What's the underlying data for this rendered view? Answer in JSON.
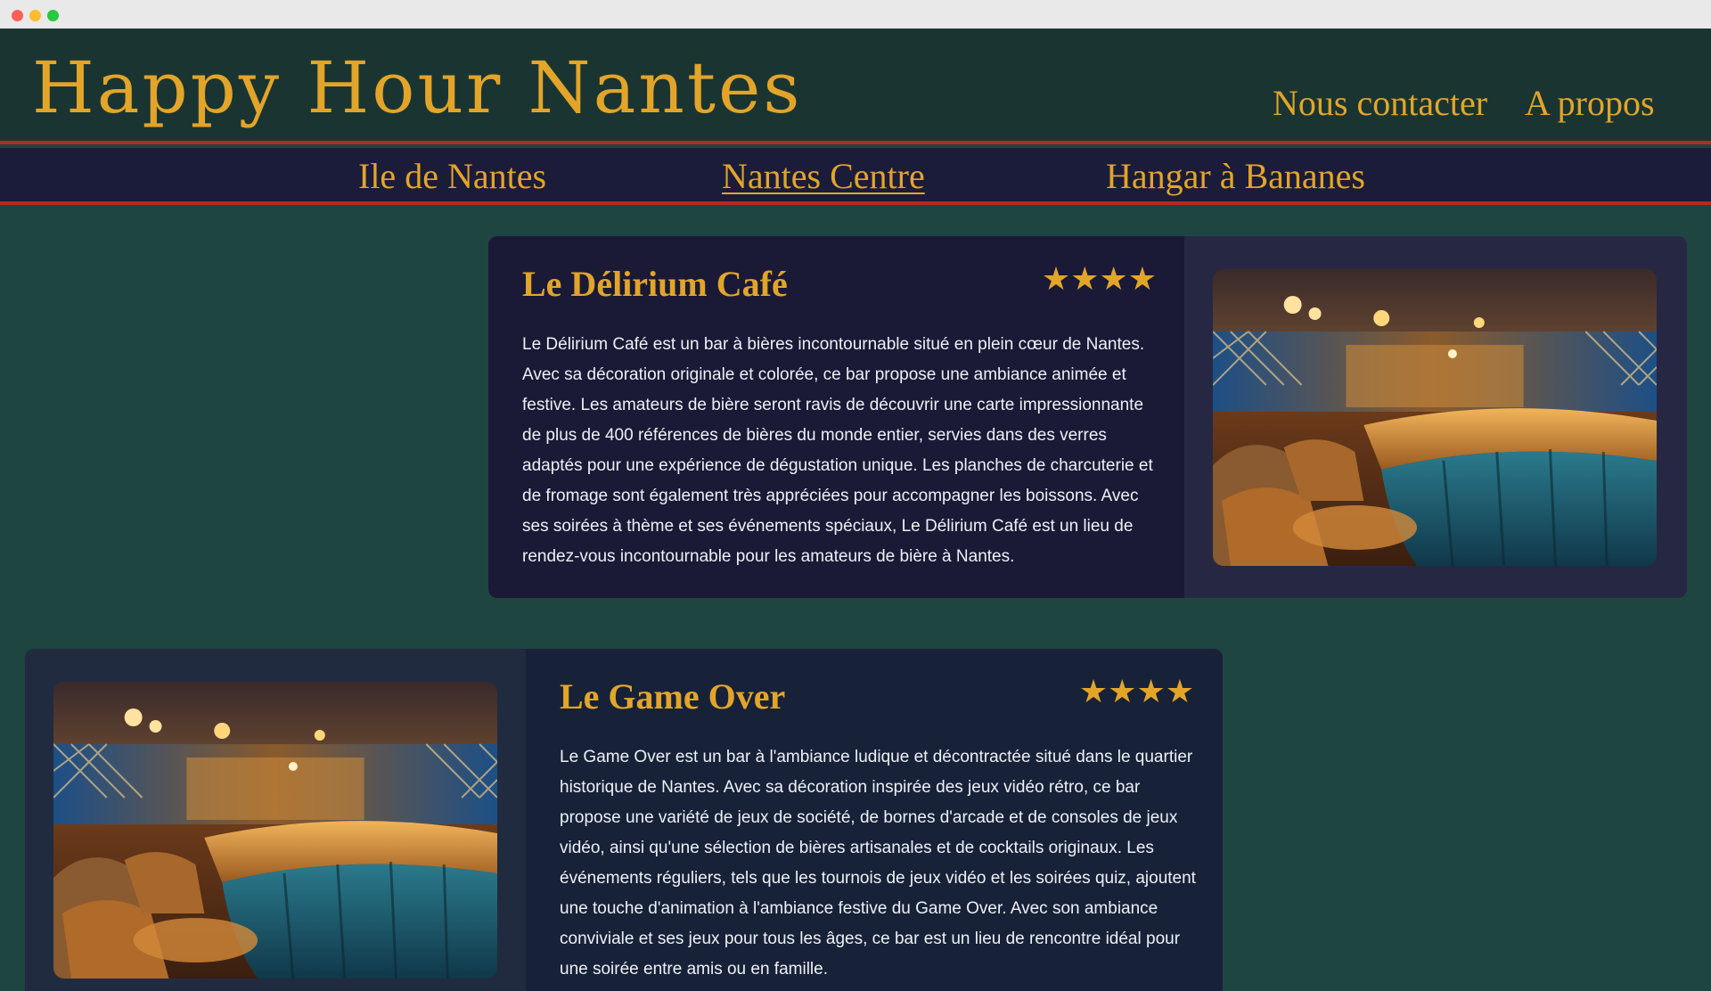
{
  "site": {
    "title": "Happy Hour Nantes"
  },
  "header": {
    "links": [
      {
        "label": "Nous contacter"
      },
      {
        "label": "A propos"
      }
    ]
  },
  "nav": {
    "items": [
      {
        "label": "Ile de Nantes",
        "active": false
      },
      {
        "label": "Nantes Centre",
        "active": true
      },
      {
        "label": "Hangar à Bananes",
        "active": false
      }
    ]
  },
  "bars": [
    {
      "name": "Le Délirium Café",
      "rating": 4,
      "stars": "★★★★",
      "description": "Le Délirium Café est un bar à bières incontournable situé en plein cœur de Nantes. Avec sa décoration originale et colorée, ce bar propose une ambiance animée et festive. Les amateurs de bière seront ravis de découvrir une carte impressionnante de plus de 400 références de bières du monde entier, servies dans des verres adaptés pour une expérience de dégustation unique. Les planches de charcuterie et de fromage sont également très appréciées pour accompagner les boissons. Avec ses soirées à thème et ses événements spéciaux, Le Délirium Café est un lieu de rendez-vous incontournable pour les amateurs de bière à Nantes."
    },
    {
      "name": "Le Game Over",
      "rating": 4,
      "stars": "★★★★",
      "description": "Le Game Over est un bar à l'ambiance ludique et décontractée situé dans le quartier historique de Nantes. Avec sa décoration inspirée des jeux vidéo rétro, ce bar propose une variété de jeux de société, de bornes d'arcade et de consoles de jeux vidéo, ainsi qu'une sélection de bières artisanales et de cocktails originaux. Les événements réguliers, tels que les tournois de jeux vidéo et les soirées quiz, ajoutent une touche d'animation à l'ambiance festive du Game Over. Avec son ambiance conviviale et ses jeux pour tous les âges, ce bar est un lieu de rencontre idéal pour une soirée entre amis ou en famille."
    }
  ],
  "colors": {
    "accent": "#e2a52a",
    "page_bg": "#1f4540",
    "header_bg": "#1a3531",
    "nav_bg": "#1b1b3a",
    "rule": "#b22a2a"
  }
}
